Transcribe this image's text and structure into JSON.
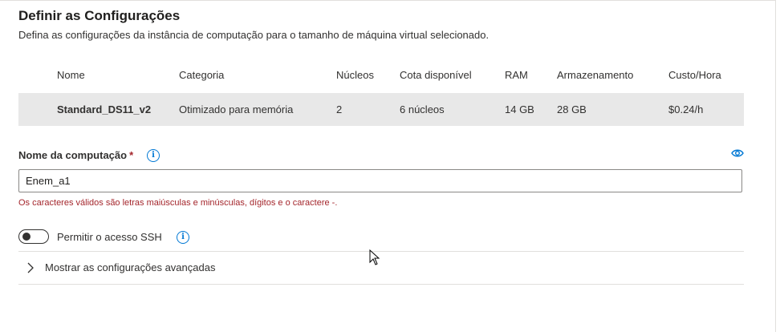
{
  "header": {
    "title": "Definir as Configurações",
    "subtitle": "Defina as configurações da instância de computação para o tamanho de máquina virtual selecionado."
  },
  "table": {
    "columns": [
      "Nome",
      "Categoria",
      "Núcleos",
      "Cota disponível",
      "RAM",
      "Armazenamento",
      "Custo/Hora"
    ],
    "rows": [
      [
        "Standard_DS11_v2",
        "Otimizado para memória",
        "2",
        "6 núcleos",
        "14 GB",
        "28 GB",
        "$0.24/h"
      ]
    ]
  },
  "compute_name": {
    "label": "Nome da computação",
    "required_mark": "*",
    "value": "Enem_a1",
    "helper": "Os caracteres válidos são letras maiúsculas e minúsculas, dígitos e o caractere -."
  },
  "ssh": {
    "label": "Permitir o acesso SSH",
    "enabled": false
  },
  "advanced": {
    "label": "Mostrar as configurações avançadas"
  },
  "icons": {
    "info": "info-icon",
    "visibility": "eye-icon",
    "expand": "chevron-right-icon"
  },
  "colors": {
    "accent": "#0078d4",
    "error": "#a4262c",
    "selected_row": "#e8e8e8"
  }
}
